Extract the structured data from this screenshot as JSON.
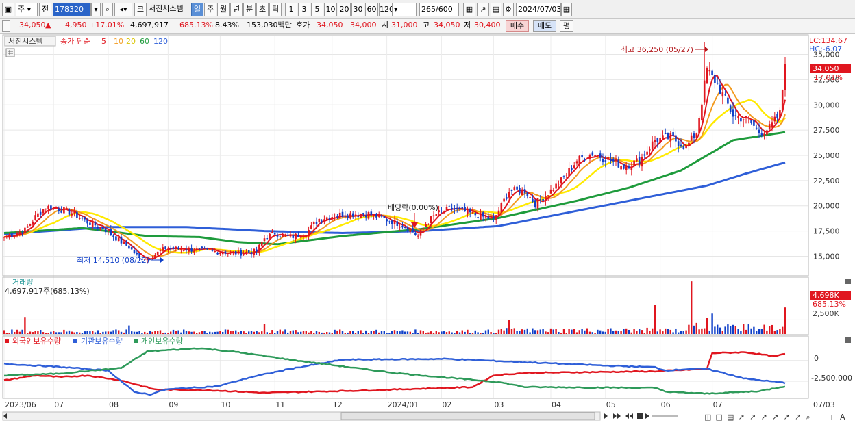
{
  "toolbar": {
    "market_select": "주",
    "prefix": "전",
    "code": "178320",
    "code_button": "코",
    "stock_name": "서진시스템",
    "periods": [
      "일",
      "주",
      "월",
      "년",
      "분",
      "초",
      "틱"
    ],
    "selected_period": "일",
    "intervals": [
      "1",
      "3",
      "5",
      "10",
      "20",
      "30",
      "60",
      "120"
    ],
    "count": "265",
    "count_total": "/600",
    "date": "2024/07/03"
  },
  "quote": {
    "price": "34,050",
    "change_arrow": "▲",
    "change": "4,950",
    "change_pct": "+17.01%",
    "volume": "4,697,917",
    "volume_ratio": "685.13%",
    "turnover_pct": "8.43%",
    "amount": "153,030백만",
    "ask_label": "호가",
    "ask": "34,050",
    "bid": "34,000",
    "open_label": "시",
    "open": "31,000",
    "high_label": "고",
    "high": "34,050",
    "low_label": "저",
    "low": "30,400",
    "buy_label": "매수",
    "sell_label": "매도",
    "avg_label": "평"
  },
  "colors": {
    "up": "#e0161f",
    "down": "#0f3fc8",
    "ma5": "#e0161f",
    "ma10": "#f29a1f",
    "ma20": "#ffea00",
    "ma60": "#1e9b3c",
    "ma120": "#2f5fd8",
    "foreign": "#e0161f",
    "institution": "#2f5fd8",
    "individual": "#2e9a5a"
  },
  "chart_data": [
    {
      "type": "candlestick",
      "title": "서진시스템",
      "legend": [
        "종가 단순",
        "5",
        "10",
        "20",
        "60",
        "120"
      ],
      "right_labels": {
        "lc": "LC:134.67",
        "hc": "HC:-6.07"
      },
      "y_ticks": [
        "35,000",
        "32,500",
        "30,000",
        "27,500",
        "25,000",
        "22,500",
        "20,000",
        "17,500",
        "15,000"
      ],
      "ylim": [
        13200,
        36800
      ],
      "x_ticks": [
        "2023/06",
        "07",
        "08",
        "09",
        "10",
        "11",
        "12",
        "2024/01",
        "02",
        "03",
        "04",
        "05",
        "06",
        "07"
      ],
      "end_date_label": "07/03",
      "last_price_label": "34,050",
      "last_pct_label": "17.01%",
      "annotations": {
        "high": {
          "text": "최고 36,250 (05/27)",
          "value": 36250
        },
        "low": {
          "text": "최저 14,510 (08/22)",
          "value": 14510
        },
        "dividend": {
          "text": "배당락(0.00%)"
        }
      },
      "close_anchors": [
        [
          0,
          16900
        ],
        [
          8,
          17600
        ],
        [
          12,
          18900
        ],
        [
          16,
          19900
        ],
        [
          20,
          19800
        ],
        [
          26,
          19300
        ],
        [
          32,
          18400
        ],
        [
          38,
          17800
        ],
        [
          44,
          16600
        ],
        [
          48,
          15900
        ],
        [
          52,
          14800
        ],
        [
          56,
          14900
        ],
        [
          62,
          15800
        ],
        [
          70,
          15700
        ],
        [
          80,
          15500
        ],
        [
          90,
          15300
        ],
        [
          97,
          15500
        ],
        [
          100,
          16800
        ],
        [
          104,
          17300
        ],
        [
          110,
          16900
        ],
        [
          116,
          17300
        ],
        [
          121,
          18700
        ],
        [
          128,
          19100
        ],
        [
          134,
          19200
        ],
        [
          140,
          19200
        ],
        [
          146,
          18700
        ],
        [
          152,
          18200
        ],
        [
          155,
          17800
        ],
        [
          159,
          17000
        ],
        [
          162,
          18200
        ],
        [
          166,
          19200
        ],
        [
          172,
          19700
        ],
        [
          177,
          19400
        ],
        [
          184,
          18900
        ],
        [
          188,
          18600
        ],
        [
          194,
          21500
        ],
        [
          200,
          21500
        ],
        [
          204,
          20200
        ],
        [
          210,
          21500
        ],
        [
          214,
          22500
        ],
        [
          220,
          24500
        ],
        [
          226,
          25200
        ],
        [
          232,
          24600
        ],
        [
          238,
          23900
        ],
        [
          244,
          24500
        ],
        [
          250,
          26500
        ],
        [
          256,
          26800
        ],
        [
          262,
          25800
        ],
        [
          266,
          27300
        ],
        [
          270,
          33500
        ],
        [
          274,
          32000
        ],
        [
          280,
          29000
        ],
        [
          286,
          28500
        ],
        [
          290,
          27300
        ],
        [
          294,
          27700
        ],
        [
          298,
          29100
        ],
        [
          300,
          34050
        ]
      ],
      "ma_anchors": {
        "ma60": [
          [
            0,
            17300
          ],
          [
            30,
            17800
          ],
          [
            55,
            17000
          ],
          [
            75,
            16900
          ],
          [
            90,
            16400
          ],
          [
            105,
            16200
          ],
          [
            130,
            17000
          ],
          [
            160,
            17700
          ],
          [
            190,
            18800
          ],
          [
            220,
            20500
          ],
          [
            240,
            21800
          ],
          [
            260,
            23500
          ],
          [
            280,
            26500
          ],
          [
            300,
            27300
          ]
        ],
        "ma120": [
          [
            0,
            17200
          ],
          [
            40,
            17900
          ],
          [
            70,
            17900
          ],
          [
            100,
            17500
          ],
          [
            130,
            17300
          ],
          [
            160,
            17500
          ],
          [
            190,
            18000
          ],
          [
            220,
            19500
          ],
          [
            250,
            21000
          ],
          [
            270,
            22000
          ],
          [
            285,
            23200
          ],
          [
            300,
            24300
          ]
        ]
      }
    },
    {
      "type": "bar",
      "title": "거래량",
      "value_label": "4,697,917주(685.13%)",
      "y_ticks": [
        "2,500K"
      ],
      "last_label": "4,698K",
      "last_pct_label": "685.13%",
      "ymax": 9800,
      "spikes": [
        [
          8,
          3000
        ],
        [
          48,
          1500
        ],
        [
          100,
          1700
        ],
        [
          194,
          2500
        ],
        [
          250,
          5200
        ],
        [
          264,
          9300
        ],
        [
          266,
          1950
        ],
        [
          270,
          2800
        ],
        [
          272,
          3600
        ],
        [
          284,
          1750
        ],
        [
          300,
          4698
        ]
      ]
    },
    {
      "type": "line",
      "legend": [
        "외국인보유수량",
        "기관보유수량",
        "개인보유수량"
      ],
      "y_ticks": [
        "0",
        "-2,500,000"
      ],
      "ylim": [
        -4400000,
        1800000
      ],
      "series": [
        {
          "name": "외국인보유수량",
          "anchors": [
            [
              0,
              -2400000
            ],
            [
              12,
              -1800000
            ],
            [
              22,
              -2000000
            ],
            [
              32,
              -1800000
            ],
            [
              45,
              -2400000
            ],
            [
              58,
              -3500000
            ],
            [
              80,
              -3600000
            ],
            [
              100,
              -3900000
            ],
            [
              140,
              -3600000
            ],
            [
              170,
              -3300000
            ],
            [
              180,
              -3200000
            ],
            [
              188,
              -1800000
            ],
            [
              200,
              -1500000
            ],
            [
              250,
              -1300000
            ],
            [
              264,
              -1100000
            ],
            [
              270,
              -1000000
            ],
            [
              272,
              900000
            ],
            [
              285,
              1000000
            ],
            [
              296,
              500000
            ],
            [
              300,
              800000
            ]
          ]
        },
        {
          "name": "기관보유수량",
          "anchors": [
            [
              0,
              -400000
            ],
            [
              18,
              -700000
            ],
            [
              40,
              -1200000
            ],
            [
              50,
              -3800000
            ],
            [
              56,
              -4100000
            ],
            [
              62,
              -3500000
            ],
            [
              82,
              -3100000
            ],
            [
              95,
              -2000000
            ],
            [
              110,
              -1000000
            ],
            [
              130,
              100000
            ],
            [
              170,
              200000
            ],
            [
              200,
              -200000
            ],
            [
              230,
              -600000
            ],
            [
              250,
              -800000
            ],
            [
              254,
              -1200000
            ],
            [
              264,
              -1000000
            ],
            [
              270,
              -1000000
            ],
            [
              285,
              -2200000
            ],
            [
              300,
              -2700000
            ]
          ]
        },
        {
          "name": "개인보유수량",
          "anchors": [
            [
              0,
              -1800000
            ],
            [
              20,
              -1600000
            ],
            [
              45,
              -900000
            ],
            [
              55,
              1100000
            ],
            [
              75,
              1500000
            ],
            [
              90,
              1000000
            ],
            [
              110,
              100000
            ],
            [
              150,
              -1500000
            ],
            [
              175,
              -2200000
            ],
            [
              190,
              -2600000
            ],
            [
              200,
              -3200000
            ],
            [
              250,
              -3300000
            ],
            [
              255,
              -3800000
            ],
            [
              270,
              -4000000
            ],
            [
              290,
              -3700000
            ],
            [
              300,
              -3100000
            ]
          ]
        }
      ]
    }
  ]
}
